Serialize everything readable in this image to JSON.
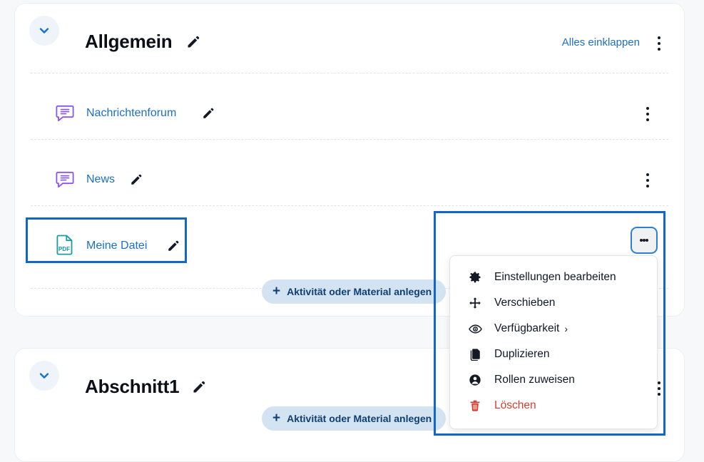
{
  "sections": [
    {
      "key": "general",
      "title": "Allgemein",
      "edit_title_icon": "pencil-icon",
      "collapse_icon": "chevron-down-icon",
      "collapse_all_label": "Alles einklappen",
      "section_menu_icon": "kebab-menu-icon",
      "activities": [
        {
          "name": "Nachrichtenforum",
          "icon": "forum-icon",
          "icon_color": "#8854f0",
          "edit_icon": "pencil-icon",
          "menu_icon": "kebab-menu-icon"
        },
        {
          "name": "News",
          "icon": "forum-icon",
          "icon_color": "#8854f0",
          "edit_icon": "pencil-icon",
          "menu_icon": "kebab-menu-icon"
        },
        {
          "name": "Meine Datei",
          "icon": "pdf-file-icon",
          "icon_color": "#1d9ba3",
          "icon_text": "PDF",
          "edit_icon": "pencil-icon",
          "menu_icon": "kebab-menu-icon"
        }
      ],
      "add_activity_label": "Aktivität oder Material anlegen",
      "add_activity_icon": "plus-icon"
    },
    {
      "key": "section1",
      "title": "Abschnitt1",
      "edit_title_icon": "pencil-icon",
      "collapse_icon": "chevron-down-icon",
      "section_menu_icon": "kebab-menu-icon",
      "activities": [],
      "add_activity_label": "Aktivität oder Material anlegen",
      "add_activity_icon": "plus-icon"
    }
  ],
  "dropdown_menu": {
    "open": true,
    "items": [
      {
        "label": "Einstellungen bearbeiten",
        "icon": "gear-icon",
        "danger": false,
        "submenu": false
      },
      {
        "label": "Verschieben",
        "icon": "move-arrows-icon",
        "danger": false,
        "submenu": false
      },
      {
        "label": "Verfügbarkeit",
        "icon": "eye-icon",
        "danger": false,
        "submenu": true,
        "submenu_caret": "›"
      },
      {
        "label": "Duplizieren",
        "icon": "duplicate-icon",
        "danger": false,
        "submenu": false
      },
      {
        "label": "Rollen zuweisen",
        "icon": "user-circle-icon",
        "danger": false,
        "submenu": false
      },
      {
        "label": "Löschen",
        "icon": "trash-icon",
        "danger": true,
        "submenu": false
      }
    ]
  },
  "annotations": [
    {
      "name": "highlight-file-activity",
      "color": "#1168c4"
    },
    {
      "name": "highlight-activity-menu",
      "color": "#1168c4"
    }
  ],
  "colors": {
    "link_blue": "#1d6fc4",
    "annotation_blue": "#1168c4",
    "pill_bg": "#d3e3f2",
    "pill_text": "#0f3f73",
    "danger_red": "#d23f31",
    "forum_purple": "#8854f0",
    "pdf_teal": "#1d9ba3",
    "card_bg": "#ffffff",
    "page_bg": "#f7f8fa"
  }
}
